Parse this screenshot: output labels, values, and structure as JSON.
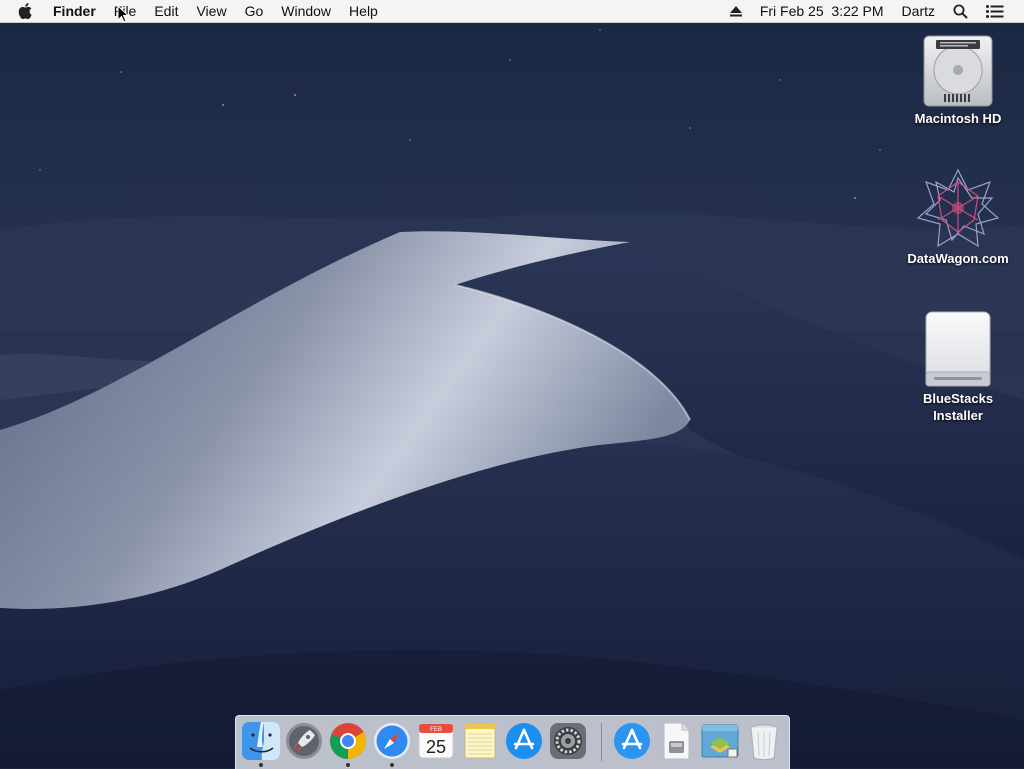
{
  "menubar": {
    "app_name": "Finder",
    "menus": [
      "File",
      "Edit",
      "View",
      "Go",
      "Window",
      "Help"
    ],
    "clock": "Fri Feb 25  3:22 PM",
    "user": "Dartz"
  },
  "desktop_icons": [
    {
      "label": "Macintosh HD",
      "icon": "hard-drive-icon"
    },
    {
      "label": "DataWagon.com",
      "icon": "geometric-star-icon"
    },
    {
      "label": "BlueStacks Installer",
      "icon": "external-disk-icon"
    }
  ],
  "dock": {
    "items": [
      {
        "name": "Finder",
        "icon": "finder-icon",
        "running": true
      },
      {
        "name": "Launchpad",
        "icon": "launchpad-icon",
        "running": false
      },
      {
        "name": "Google Chrome",
        "icon": "chrome-icon",
        "running": true
      },
      {
        "name": "Safari",
        "icon": "safari-icon",
        "running": true
      },
      {
        "name": "Calendar",
        "icon": "calendar-icon",
        "running": false,
        "month": "FEB",
        "day": "25"
      },
      {
        "name": "Notes",
        "icon": "notes-icon",
        "running": false
      },
      {
        "name": "App Store",
        "icon": "app-store-icon",
        "running": false
      },
      {
        "name": "System Preferences",
        "icon": "system-preferences-icon",
        "running": false
      },
      {
        "name": "App Store",
        "icon": "app-store-icon",
        "running": false
      },
      {
        "name": "Disk image",
        "icon": "disk-image-icon",
        "running": false
      },
      {
        "name": "Installer",
        "icon": "installer-icon",
        "running": false
      },
      {
        "name": "Trash",
        "icon": "trash-icon",
        "running": false
      }
    ]
  },
  "colors": {
    "menubar_bg": "#f4f4f4",
    "sky_top": "#1d2a45",
    "dune_light": "#c9d0dd",
    "dock_bg": "#e6e9f0"
  }
}
